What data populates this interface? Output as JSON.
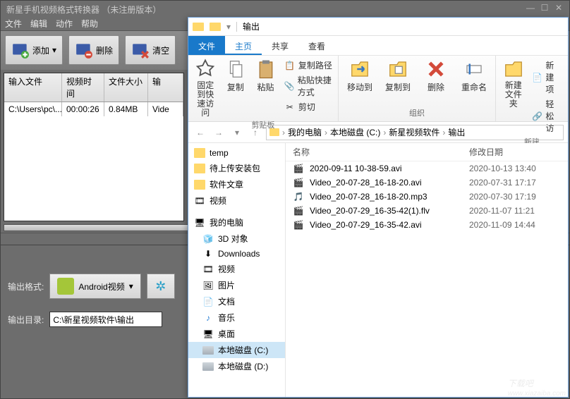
{
  "app": {
    "title": "新星手机视频格式转换器  （未注册版本）",
    "menu": {
      "file": "文件",
      "edit": "编辑",
      "action": "动作",
      "help": "帮助"
    },
    "toolbar": {
      "add": "添加",
      "delete": "删除",
      "clear": "清空"
    },
    "grid": {
      "headers": {
        "input": "输入文件",
        "duration": "视频时间",
        "size": "文件大小",
        "status": "输"
      },
      "row": {
        "input": "C:\\Users\\pc\\...",
        "duration": "00:00:26",
        "size": "0.84MB",
        "status": "Vide"
      }
    },
    "output": {
      "format_label": "输出格式:",
      "format_value": "Android视频",
      "dir_label": "输出目录:",
      "dir_value": "C:\\新星视频软件\\输出"
    }
  },
  "explorer": {
    "window_folder": "输出",
    "tabs": {
      "file": "文件",
      "home": "主页",
      "share": "共享",
      "view": "查看"
    },
    "ribbon": {
      "pin": "固定到快速访问",
      "copy": "复制",
      "paste": "粘贴",
      "copy_path": "复制路径",
      "paste_shortcut": "粘贴快捷方式",
      "cut": "剪切",
      "group_clipboard": "剪贴板",
      "moveto": "移动到",
      "copyto": "复制到",
      "delete": "删除",
      "rename": "重命名",
      "group_organize": "组织",
      "newfolder": "新建文件夹",
      "newitem": "新建项",
      "easyaccess": "轻松访",
      "group_new": "新建"
    },
    "breadcrumb": [
      "我的电脑",
      "本地磁盘 (C:)",
      "新星视频软件",
      "输出"
    ],
    "tree": {
      "temp": "temp",
      "pending": "待上传安装包",
      "articles": "软件文章",
      "video": "视频",
      "mypc": "我的电脑",
      "obj3d": "3D 对象",
      "downloads": "Downloads",
      "video2": "视频",
      "pictures": "图片",
      "documents": "文档",
      "music": "音乐",
      "desktop": "桌面",
      "drive_c": "本地磁盘 (C:)",
      "drive_d": "本地磁盘 (D:)"
    },
    "columns": {
      "name": "名称",
      "modified": "修改日期"
    },
    "files": [
      {
        "name": "2020-09-11 10-38-59.avi",
        "date": "2020-10-13 13:40",
        "type": "avi"
      },
      {
        "name": "Video_20-07-28_16-18-20.avi",
        "date": "2020-07-31 17:17",
        "type": "avi"
      },
      {
        "name": "Video_20-07-28_16-18-20.mp3",
        "date": "2020-07-30 17:19",
        "type": "mp3"
      },
      {
        "name": "Video_20-07-29_16-35-42(1).flv",
        "date": "2020-11-07 11:21",
        "type": "flv"
      },
      {
        "name": "Video_20-07-29_16-35-42.avi",
        "date": "2020-11-09 14:44",
        "type": "avi"
      }
    ]
  },
  "watermark": {
    "main": "下载吧",
    "sub": "www.xiazaiba.com"
  }
}
